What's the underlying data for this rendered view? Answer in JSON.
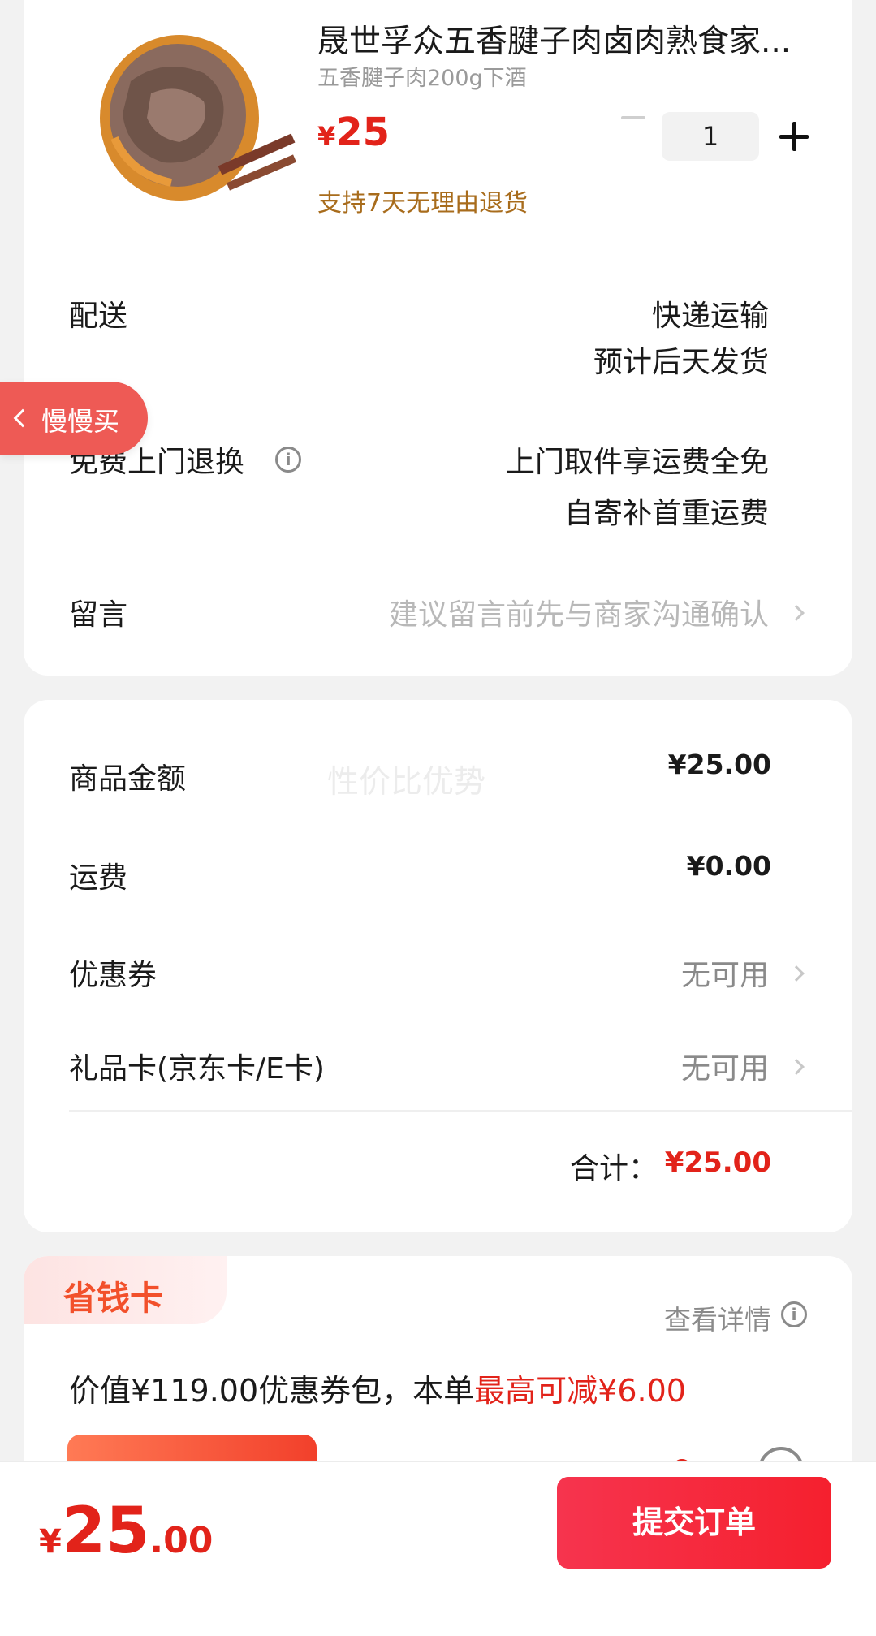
{
  "product": {
    "title": "晟世孚众五香腱子肉卤肉熟食家...",
    "subtitle": "五香腱子肉200g下酒",
    "price_currency": "¥",
    "price": "25",
    "quantity": "1",
    "return_policy": "支持7天无理由退货",
    "icons": {
      "minus": "minus-icon",
      "plus": "plus-icon"
    }
  },
  "delivery": {
    "label": "配送",
    "method": "快递运输",
    "estimate": "预计后天发货"
  },
  "free_return": {
    "label": "免费上门退换",
    "line1": "上门取件享运费全免",
    "line2": "自寄补首重运费",
    "icon": "info-icon"
  },
  "message": {
    "label": "留言",
    "placeholder": "建议留言前先与商家沟通确认"
  },
  "summary": {
    "watermark": "性价比优势",
    "goods_label": "商品金额",
    "goods_value": "¥25.00",
    "shipping_label": "运费",
    "shipping_value": "¥0.00",
    "coupon_label": "优惠券",
    "coupon_value": "无可用",
    "giftcard_label": "礼品卡(京东卡/E卡)",
    "giftcard_value": "无可用",
    "total_label": "合计：",
    "total_value": "¥25.00"
  },
  "saver_card": {
    "title": "省钱卡",
    "details": "查看详情",
    "desc_prefix": "价值¥119.00优惠券包，本单",
    "desc_highlight": "最高可减¥6.00"
  },
  "float_tag": {
    "label": "慢慢买"
  },
  "bottom": {
    "currency": "¥",
    "price_int": "25",
    "price_dec": ".00",
    "submit": "提交订单"
  },
  "colors": {
    "accent": "#e2231a",
    "submit": "#f5202e",
    "return_policy": "#a86c1c"
  }
}
